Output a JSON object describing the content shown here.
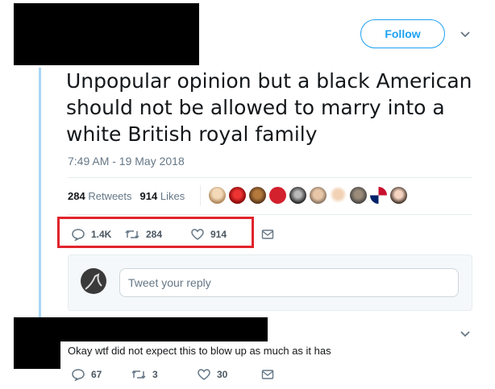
{
  "tweet": {
    "follow_label": "Follow",
    "text": "Unpopular opinion but a black American should not be allowed to marry into a white British royal family",
    "timestamp": "7:49 AM - 19 May 2018",
    "retweets_count": "284",
    "retweets_label": "Retweets",
    "likes_count": "914",
    "likes_label": "Likes",
    "actions": {
      "replies": "1.4K",
      "retweets": "284",
      "likes": "914"
    }
  },
  "composer": {
    "placeholder": "Tweet your reply"
  },
  "reply": {
    "text": "Okay wtf did not expect this to blow up as much as it has",
    "actions": {
      "replies": "67",
      "retweets": "3",
      "likes": "30"
    }
  },
  "colors": {
    "accent": "#1da1f2",
    "highlight": "#e0242b",
    "thread_line": "#a9d6f5"
  }
}
